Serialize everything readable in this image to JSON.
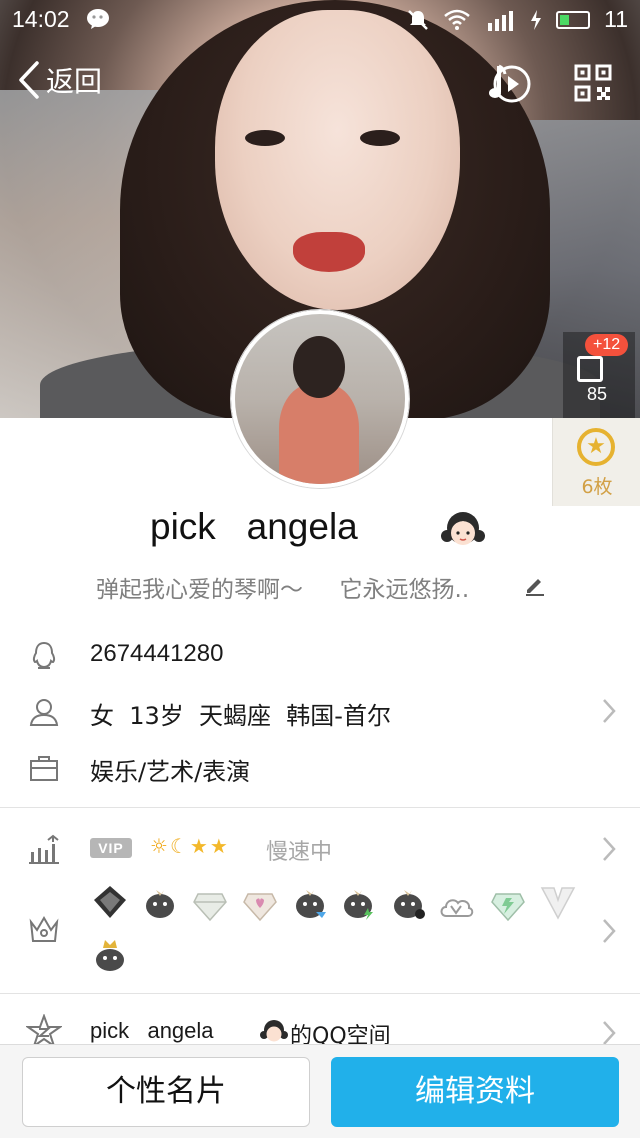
{
  "status_bar": {
    "time": "14:02",
    "battery_percent": "11"
  },
  "nav": {
    "back_label": "返回"
  },
  "likes": {
    "new_badge": "+12",
    "count": "85"
  },
  "medals": {
    "count": "6枚"
  },
  "profile": {
    "name": "pick   angela",
    "signature": "弹起我心爱的琴啊～     它永远悠扬.."
  },
  "info": {
    "qq_number": "2674441280",
    "personal": "女  13岁  天蝎座  韩国-首尔",
    "occupation": "娱乐/艺术/表演"
  },
  "vip": {
    "badge": "VIP",
    "level_icons": [
      "sun",
      "moon",
      "star",
      "star"
    ],
    "status": "慢速中"
  },
  "qzone": {
    "name": "pick   angela",
    "suffix": "的QQ空间"
  },
  "buttons": {
    "card": "个性名片",
    "edit": "编辑资料"
  },
  "colors": {
    "accent": "#21b0ea",
    "badge_red": "#f4513c",
    "medal_gold": "#e6b230"
  }
}
